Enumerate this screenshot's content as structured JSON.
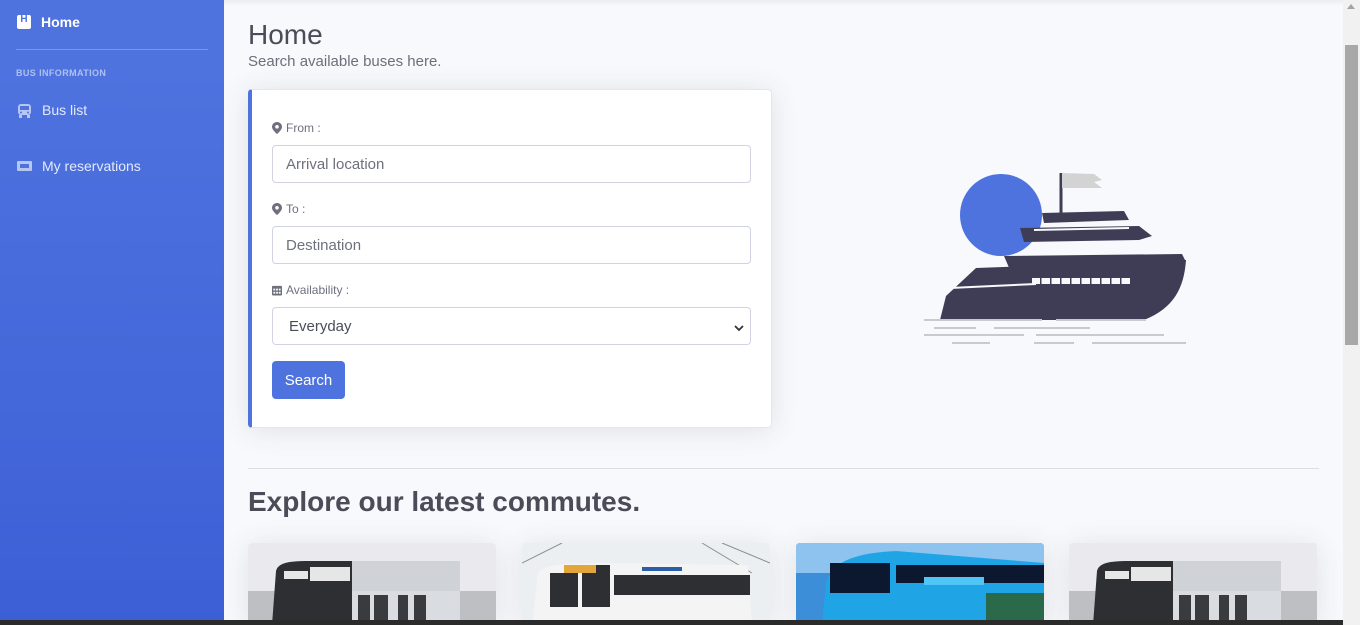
{
  "sidebar": {
    "home_label": "Home",
    "home_icon": "h-square-icon",
    "heading": "BUS INFORMATION",
    "items": [
      {
        "label": "Bus list",
        "icon": "bus-icon"
      },
      {
        "label": "My reservations",
        "icon": "ticket-icon"
      }
    ]
  },
  "page": {
    "title": "Home",
    "subtitle": "Search available buses here."
  },
  "form": {
    "from_label": "From :",
    "from_placeholder": "Arrival location",
    "to_label": "To :",
    "to_placeholder": "Destination",
    "availability_label": "Availability :",
    "availability_value": "Everyday",
    "search_label": "Search"
  },
  "explore": {
    "title": "Explore our latest commutes."
  },
  "colors": {
    "accent": "#4e73df",
    "illustration_dark": "#3f3d56",
    "background": "#f8f9fc"
  }
}
